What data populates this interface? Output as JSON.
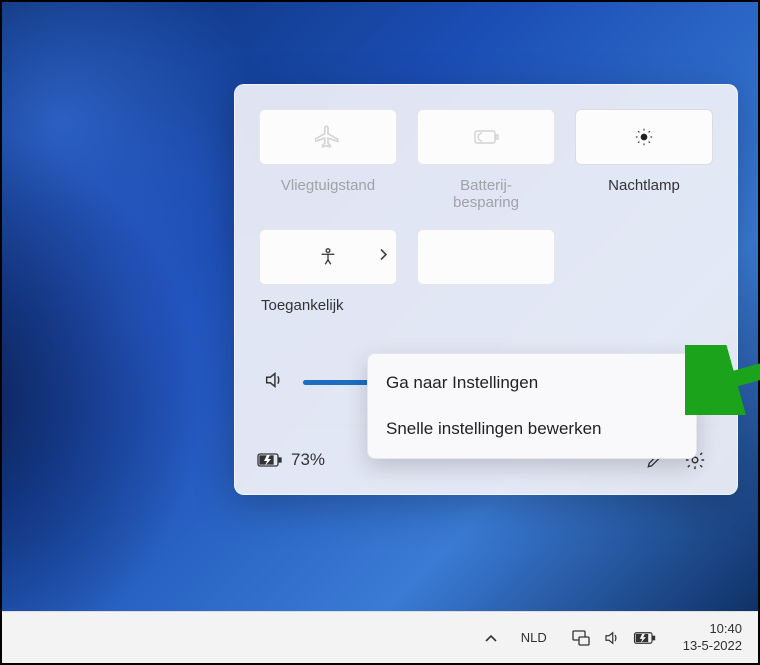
{
  "panel": {
    "tiles": [
      {
        "id": "airplane",
        "label": "Vliegtuigstand",
        "icon": "airplane-icon",
        "enabled": false
      },
      {
        "id": "battery-saver",
        "label": "Batterij-\nbesparing",
        "icon": "battery-saver-icon",
        "enabled": false
      },
      {
        "id": "nightlight",
        "label": "Nachtlamp",
        "icon": "nightlight-icon",
        "enabled": true
      },
      {
        "id": "accessibility",
        "label": "Toegankelijk",
        "icon": "accessibility-icon",
        "enabled": true,
        "hasSubmenu": true
      }
    ],
    "volume_percent": 50,
    "footer": {
      "battery_text": "73%"
    }
  },
  "context_menu": {
    "items": [
      "Ga naar Instellingen",
      "Snelle instellingen bewerken"
    ]
  },
  "taskbar": {
    "language": "NLD",
    "clock_time": "10:40",
    "clock_date": "13-5-2022"
  }
}
